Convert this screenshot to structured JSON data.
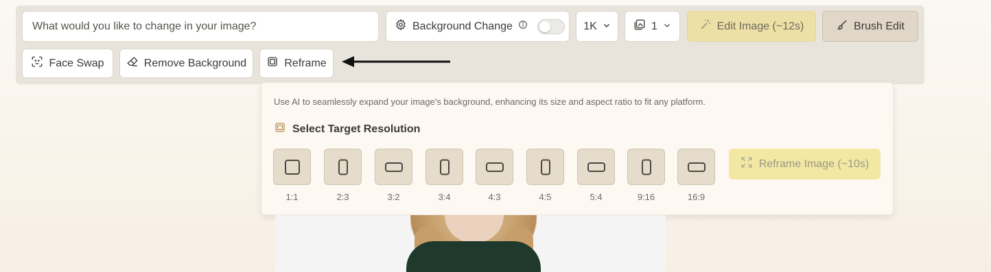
{
  "toolbar": {
    "prompt_placeholder": "What would you like to change in your image?",
    "background_change_label": "Background Change",
    "background_change_enabled": false,
    "resolution_value": "1K",
    "image_count_value": "1",
    "edit_image_label": "Edit Image (~12s)",
    "brush_edit_label": "Brush Edit",
    "face_swap_label": "Face Swap",
    "remove_background_label": "Remove Background",
    "reframe_label": "Reframe"
  },
  "reframe_panel": {
    "description": "Use AI to seamlessly expand your image's background, enhancing its size and aspect ratio to fit any platform.",
    "select_title": "Select Target Resolution",
    "ratios": [
      "1:1",
      "2:3",
      "3:2",
      "3:4",
      "4:3",
      "4:5",
      "5:4",
      "9:16",
      "16:9"
    ],
    "reframe_button_label": "Reframe Image (~10s)"
  },
  "colors": {
    "accent_yellow": "#ede0a6",
    "ratio_tile": "#e6dccb",
    "toolbar_bg": "#e8e4dc"
  },
  "icons": {
    "background_change": "gear-icon",
    "info": "info-icon",
    "resolution_dropdown": "chevron-down-icon",
    "image_count": "images-icon",
    "edit_image": "magic-wand-icon",
    "brush_edit": "brush-icon",
    "face_swap": "face-scan-icon",
    "remove_background": "eraser-icon",
    "reframe": "reframe-icon",
    "reframe_image": "expand-icon"
  }
}
